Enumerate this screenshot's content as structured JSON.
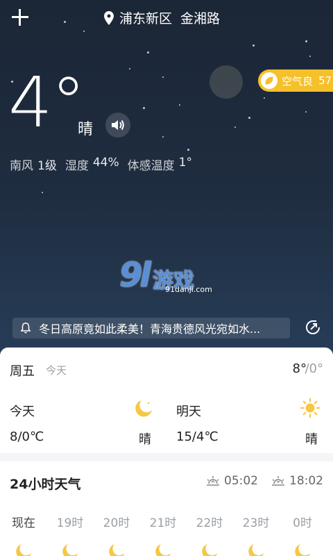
{
  "location": {
    "district": "浦东新区",
    "road": "金湘路"
  },
  "current": {
    "temperature": "4°",
    "condition": "晴",
    "details": [
      {
        "label": "南风",
        "value": "1级"
      },
      {
        "label": "湿度",
        "value": "44%"
      },
      {
        "label": "体感温度",
        "value": "1°"
      }
    ]
  },
  "aqi": {
    "label": "空气良",
    "value": "57",
    "color": "#f5c02a"
  },
  "watermark": {
    "logo": "9l",
    "text": "游戏",
    "site": "91danji.com"
  },
  "news": {
    "text": "冬日高原竟如此柔美！青海贵德风光宛如水..."
  },
  "today": {
    "day": "周五",
    "sub": "今天",
    "high": "8°",
    "low": "/0°"
  },
  "forecast": [
    {
      "name": "今天",
      "range": "8/0℃",
      "condition": "晴",
      "icon": "moon-icon"
    },
    {
      "name": "明天",
      "range": "15/4℃",
      "condition": "晴",
      "icon": "sun-icon"
    }
  ],
  "hourly": {
    "title": "24小时天气",
    "sunrise": "05:02",
    "sunset": "18:02",
    "hours": [
      "现在",
      "19时",
      "20时",
      "21时",
      "22时",
      "23时",
      "0时"
    ]
  }
}
